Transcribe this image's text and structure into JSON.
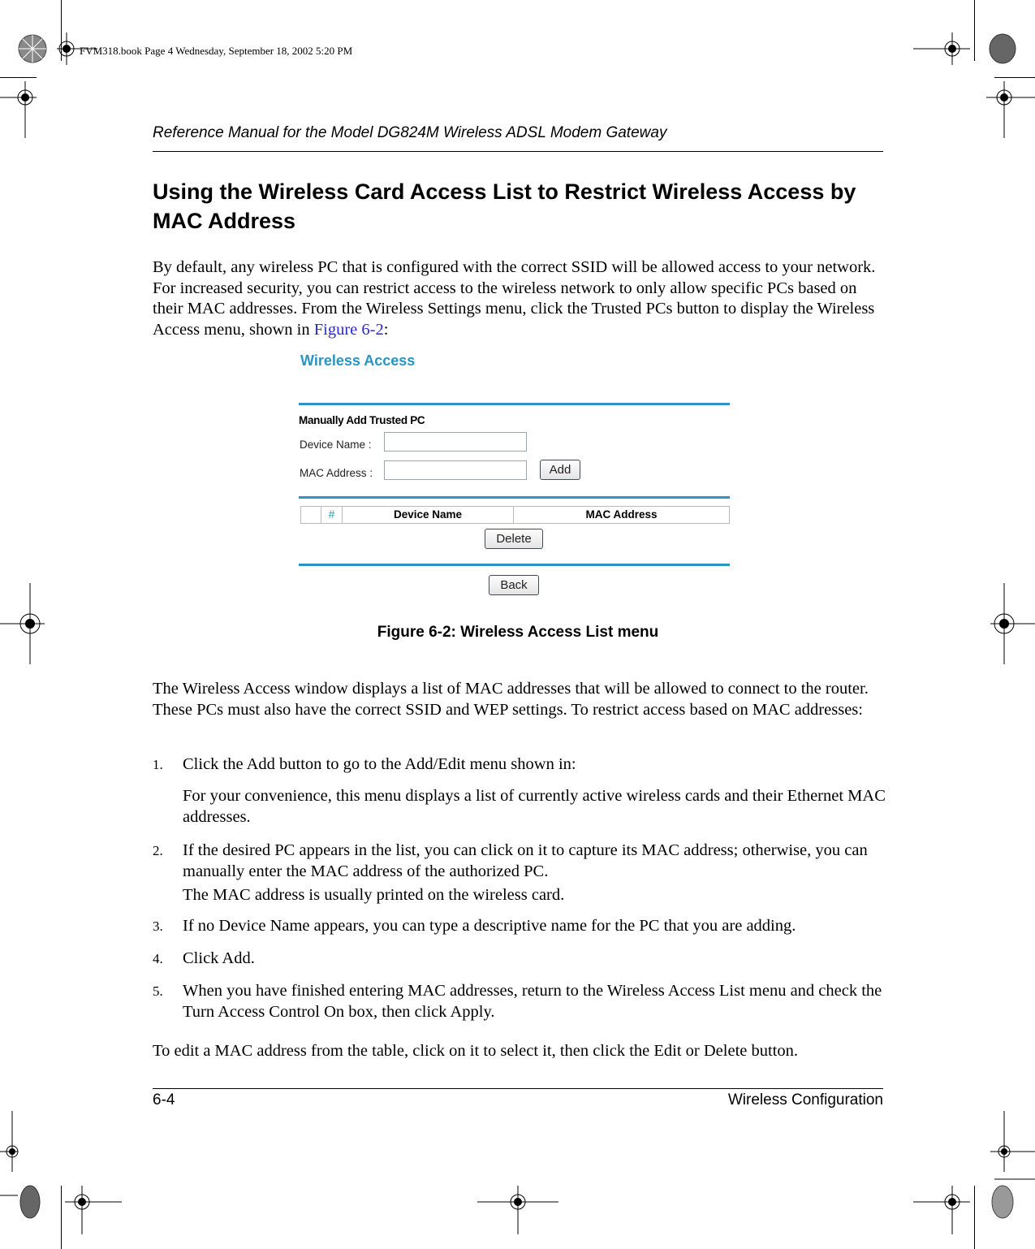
{
  "slug": "FVM318.book  Page 4  Wednesday, September 18, 2002  5:20 PM",
  "running_head": "Reference Manual for the Model DG824M Wireless ADSL Modem Gateway",
  "heading": "Using the Wireless Card Access List to Restrict Wireless Access by MAC Address",
  "intro": {
    "text": "By default, any wireless PC that is configured with the correct SSID will be allowed access to your network. For increased security, you can restrict access to the wireless network to only allow specific PCs based on their MAC addresses. From the Wireless Settings menu, click the Trusted PCs button to display the Wireless Access menu, shown in ",
    "link": "Figure 6-2",
    "after": ":"
  },
  "figure": {
    "title": "Wireless Access",
    "section": "Manually Add Trusted PC",
    "device_name_label": "Device Name :",
    "device_name_value": "",
    "mac_address_label": "MAC Address :",
    "mac_address_value": "",
    "add_button": "Add",
    "table_headers": [
      "",
      "#",
      "Device Name",
      "MAC Address"
    ],
    "delete_button": "Delete",
    "back_button": "Back",
    "accent_color": "#2b94c0"
  },
  "caption": "Figure 6-2:  Wireless Access List menu",
  "para2": "The Wireless Access window displays a list of MAC addresses that will be allowed to connect to the router. These PCs must also have the correct SSID and WEP settings. To restrict access based on MAC addresses:",
  "steps": [
    {
      "num": "1.",
      "text": "Click the Add button to go to the Add/Edit menu shown in:",
      "note": "For your convenience, this menu displays a list of currently active wireless cards and their Ethernet MAC addresses."
    },
    {
      "num": "2.",
      "text": "If the desired PC appears in the list, you can click on it to capture its MAC address; otherwise, you can manually enter the MAC address of the authorized PC.",
      "note": "The MAC address is usually printed on the wireless card."
    },
    {
      "num": "3.",
      "text": "If no Device Name appears, you can type a descriptive name for the PC that you are adding."
    },
    {
      "num": "4.",
      "text": "Click Add."
    },
    {
      "num": "5.",
      "text": "When you have finished entering MAC addresses, return to the Wireless Access List menu and check the Turn Access Control On box, then click Apply."
    }
  ],
  "closing": "To edit a MAC address from the table, click on it to select it, then click the Edit or Delete button.",
  "footer": {
    "page": "6-4",
    "chapter": "Wireless Configuration"
  }
}
